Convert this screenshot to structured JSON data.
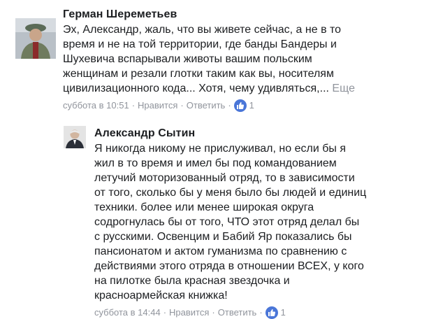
{
  "comments": [
    {
      "author": "Герман Шереметьев",
      "text": "Эх, Александр, жаль, что вы живете сейчас, а не в то\nвремя и не на той территории, где банды Бандеры и\nШухевича вспарывали животы вашим польским\nженщинам и резали глотки таким как вы, носителям\nцивилизационного кода...  Хотя, чему удивляться,...",
      "more_label": "Еще",
      "time": "суббота в 10:51",
      "like_label": "Нравится",
      "reply_label": "Ответить",
      "like_count": "1"
    },
    {
      "author": "Александр Сытин",
      "text": "Я никогда никому не прислуживал, но если бы я\nжил в то время и имел бы под командованием\nлетучий моторизованный отряд, то в зависимости\nот того, сколько бы у меня было бы людей и единиц\nтехники. более или менее широкая округа\nсодрогнулась бы от того, ЧТО этот отряд делал бы\nс русскими. Освенцим и Бабий Яр показались бы\nпансионатом и актом гуманизма по сравнению с\nдействиями этого отряда в отношении ВСЕХ, у кого\nна пилотке была красная звездочка и\nкрасноармейская книжка!",
      "time": "суббота в 14:44",
      "like_label": "Нравится",
      "reply_label": "Ответить",
      "like_count": "1"
    }
  ],
  "separator": "·",
  "colors": {
    "meta": "#90949c",
    "like_badge": "#4a76d8",
    "text": "#1c1e21"
  }
}
